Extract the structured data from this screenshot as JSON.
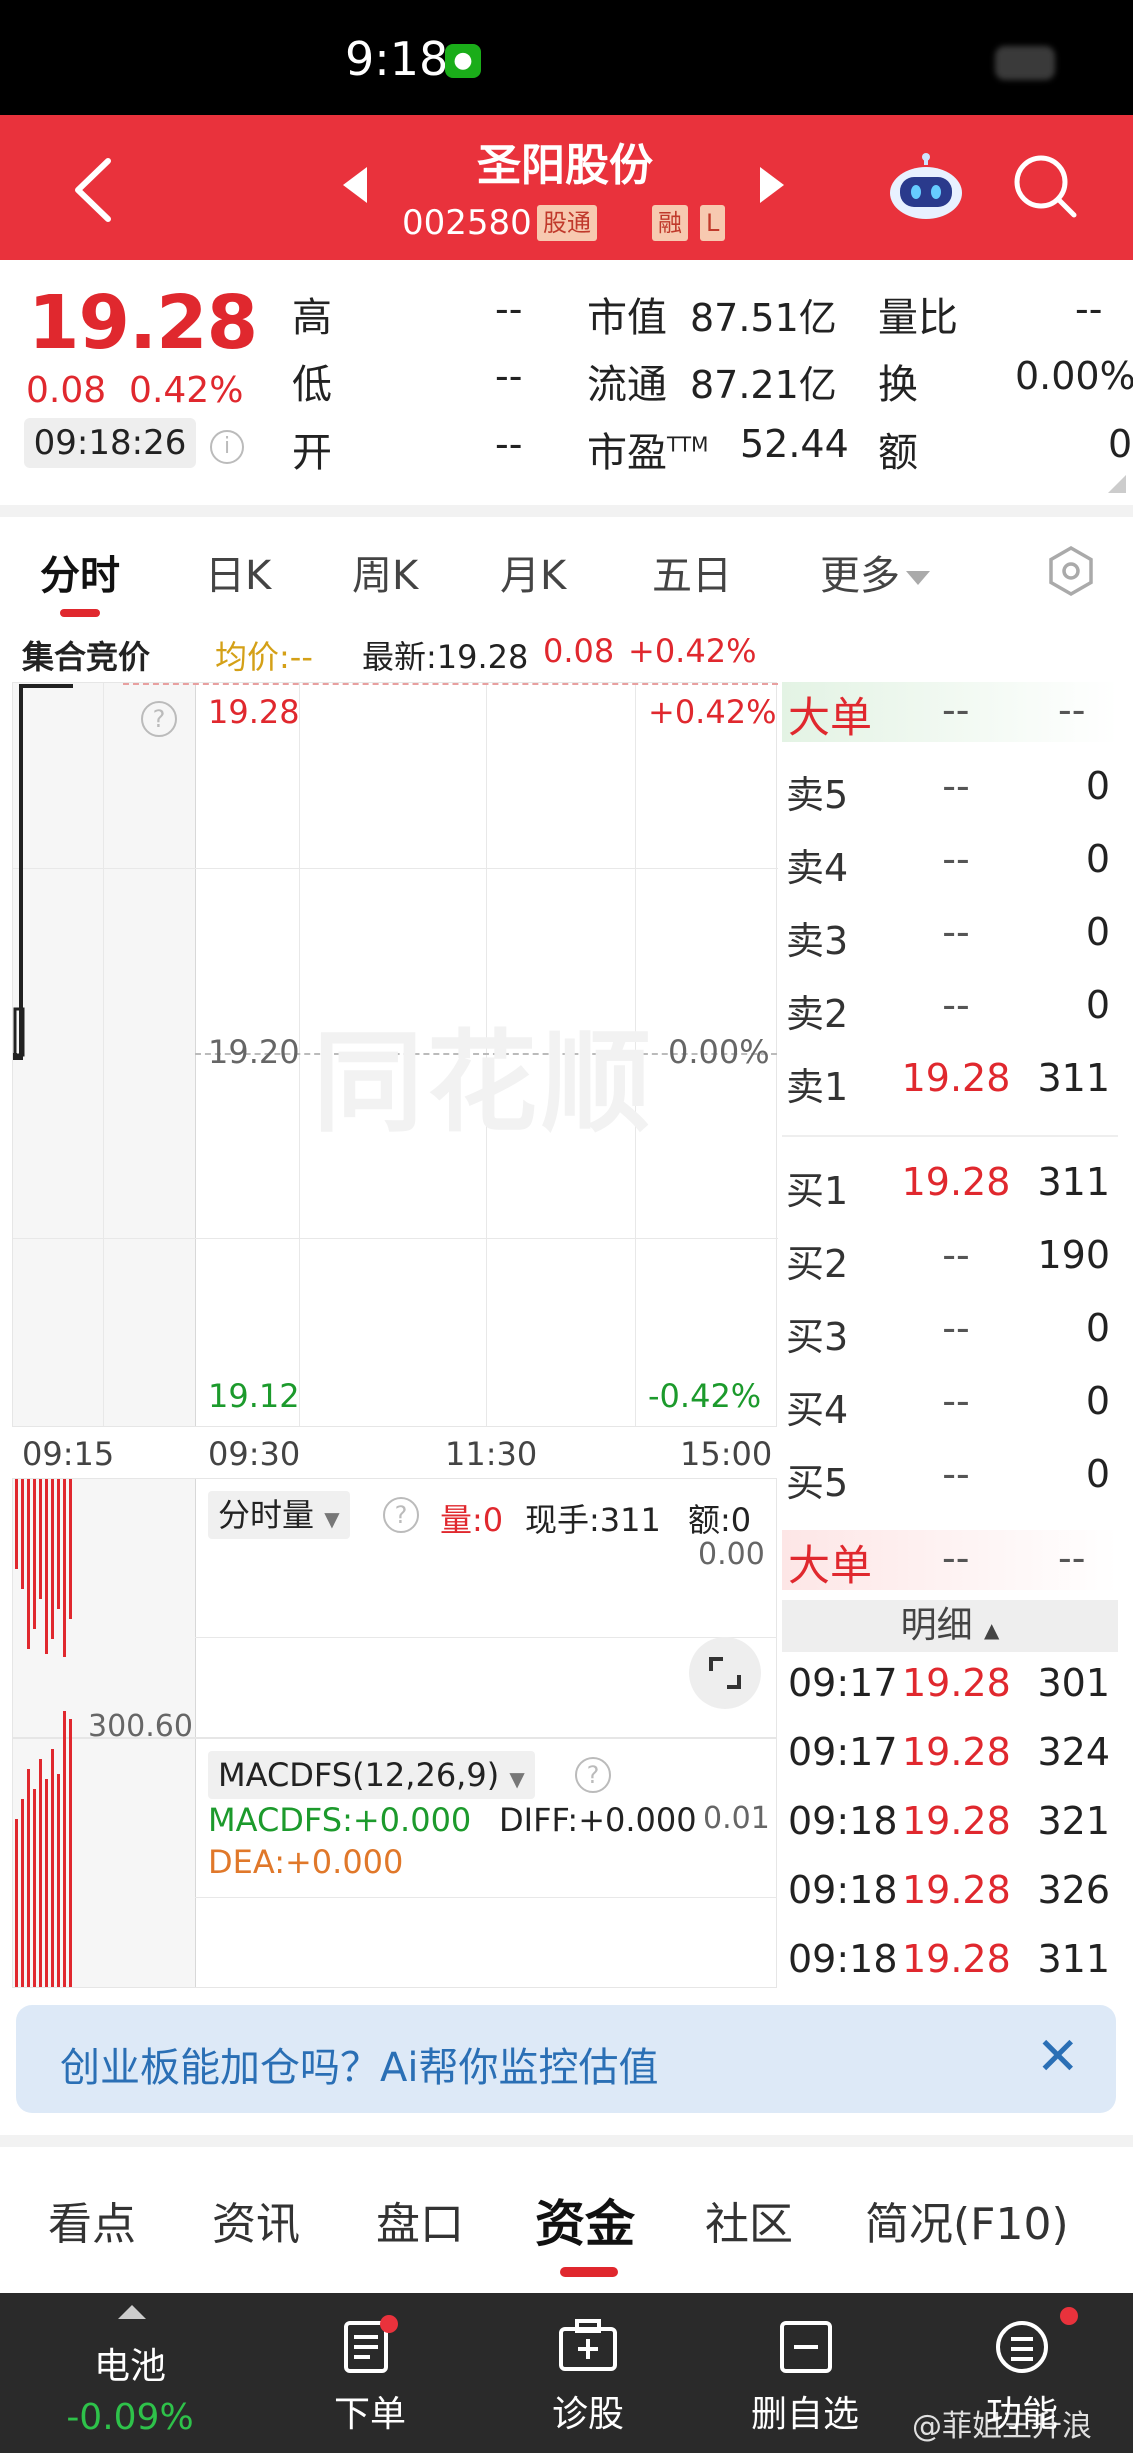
{
  "status_bar": {
    "time": "9:18"
  },
  "header": {
    "stock_name": "圣阳股份",
    "stock_code": "002580",
    "tags": [
      "股通",
      "融",
      "L"
    ]
  },
  "quote": {
    "price": "19.28",
    "change": "0.08",
    "change_pct": "0.42%",
    "time": "09:18:26",
    "fields": [
      {
        "label": "高",
        "value": "--"
      },
      {
        "label": "低",
        "value": "--"
      },
      {
        "label": "开",
        "value": "--"
      },
      {
        "label": "市值",
        "value": "87.51亿"
      },
      {
        "label": "流通",
        "value": "87.21亿"
      },
      {
        "label": "市盈",
        "sup": "TTM",
        "value": "52.44"
      },
      {
        "label": "量比",
        "value": "--"
      },
      {
        "label": "换",
        "value": "0.00%"
      },
      {
        "label": "额",
        "value": "0"
      }
    ]
  },
  "chart_tabs": [
    "分时",
    "日K",
    "周K",
    "月K",
    "五日",
    "更多"
  ],
  "info_strip": {
    "mode": "集合竞价",
    "avg_label": "均价:--",
    "latest_label": "最新:19.28",
    "latest_change": "0.08",
    "latest_pct": "+0.42%"
  },
  "price_chart": {
    "top_price": "19.28",
    "top_pct": "+0.42%",
    "mid_price": "19.20",
    "mid_pct": "0.00%",
    "bottom_price": "19.12",
    "bottom_pct": "-0.42%",
    "time_labels": [
      "09:15",
      "09:30",
      "11:30",
      "15:00"
    ],
    "watermark": "同花顺"
  },
  "volume_panel": {
    "selector": "分时量",
    "vol_label": "量:0",
    "hand_label": "现手:311",
    "amount_label": "额:0",
    "right_value": "0.00",
    "left_value": "300.60"
  },
  "macd_panel": {
    "selector": "MACDFS(12,26,9)",
    "macdfs": "MACDFS:+0.000",
    "diff": "DIFF:+0.000",
    "dea": "DEA:+0.000",
    "right_value": "0.01"
  },
  "order_book": {
    "dadan_label": "大单",
    "dadan_top": [
      "--",
      "--"
    ],
    "asks": [
      {
        "label": "卖5",
        "price": "--",
        "vol": "0"
      },
      {
        "label": "卖4",
        "price": "--",
        "vol": "0"
      },
      {
        "label": "卖3",
        "price": "--",
        "vol": "0"
      },
      {
        "label": "卖2",
        "price": "--",
        "vol": "0"
      },
      {
        "label": "卖1",
        "price": "19.28",
        "vol": "311"
      }
    ],
    "bids": [
      {
        "label": "买1",
        "price": "19.28",
        "vol": "311"
      },
      {
        "label": "买2",
        "price": "--",
        "vol": "190"
      },
      {
        "label": "买3",
        "price": "--",
        "vol": "0"
      },
      {
        "label": "买4",
        "price": "--",
        "vol": "0"
      },
      {
        "label": "买5",
        "price": "--",
        "vol": "0"
      }
    ],
    "dadan_bottom": [
      "--",
      "--"
    ],
    "detail_label": "明细",
    "ticks": [
      {
        "time": "09:17",
        "price": "19.28",
        "vol": "301"
      },
      {
        "time": "09:17",
        "price": "19.28",
        "vol": "324"
      },
      {
        "time": "09:18",
        "price": "19.28",
        "vol": "321"
      },
      {
        "time": "09:18",
        "price": "19.28",
        "vol": "326"
      },
      {
        "time": "09:18",
        "price": "19.28",
        "vol": "311"
      }
    ]
  },
  "banner": {
    "text": "创业板能加仓吗？Ai帮你监控估值"
  },
  "bottom_tabs": [
    "看点",
    "资讯",
    "盘口",
    "资金",
    "社区",
    "简况(F10)"
  ],
  "bottom_bar": {
    "battery_label": "电池",
    "battery_pct": "-0.09%",
    "items": [
      "下单",
      "诊股",
      "删自选",
      "功能"
    ],
    "watermark": "@菲姐王升浪"
  },
  "colors": {
    "header_red": "#e9323c",
    "up_red": "#e0282e",
    "down_green": "#1c9a2c"
  }
}
